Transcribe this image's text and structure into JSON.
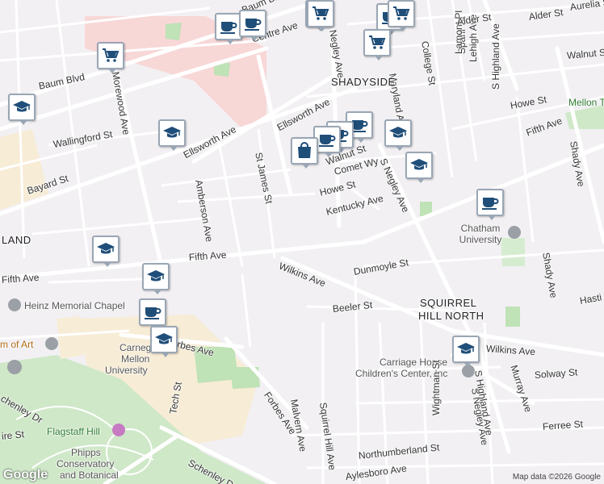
{
  "map": {
    "attribution": "Map data ©2026 Google",
    "logo_text": "Google",
    "colors": {
      "marker_icon": "#1f4e79",
      "marker_border": "#9aa6b4",
      "park": "#cfe8c8",
      "campus": "#f4cccc"
    },
    "labels": {
      "baum_blvd_1": "Baum Blvd",
      "baum_blvd_2": "Baum Blvd",
      "centre_ave": "Centre Ave",
      "s_negley_ave_1": "S Negley Ave",
      "s_negley_ave_2": "S Negley Ave",
      "negley_ave": "Negley Ave",
      "maryland_ave": "Maryland Ave",
      "college_st": "College St",
      "spahr_st": "Spahr St",
      "lamont_pl": "Lamont Pl",
      "lehigh_ave": "Lehigh Ave",
      "s_highland_ave": "S Highland Ave",
      "alder_st_1": "Alder St",
      "alder_st_2": "Alder St",
      "aurelia_st": "Aurelia St",
      "walnut_st_1": "Walnut St",
      "walnut_st_2": "Walnut St",
      "shadyside": "SHADYSIDE",
      "howe_st_1": "Howe St",
      "howe_st_2": "Howe St",
      "fifth_ave_1": "Fifth Ave",
      "fifth_ave_2": "Fifth Ave",
      "fifth_ave_3": "Fifth Ave",
      "shady_ave_1": "Shady Ave",
      "shady_ave_2": "Shady Ave",
      "mellon_tennis": "Mellon Tennis",
      "morewood_ave": "Morewood Ave",
      "wallingford_st": "Wallingford St",
      "ellsworth_ave_1": "Ellsworth Ave",
      "ellsworth_ave_2": "Ellsworth Ave",
      "st_james_st": "St James St",
      "amberson_ave": "Amberson Ave",
      "bayard_st": "Bayard St",
      "comet_wy": "Comet Wy",
      "kentucky_ave": "Kentucky Ave",
      "chatham_university": "Chatham University",
      "wilkins_ave_1": "Wilkins Ave",
      "wilkins_ave_2": "Wilkins Ave",
      "dunmoyle_st": "Dunmoyle St",
      "squirrel_hill_north_1": "SQUIRREL",
      "squirrel_hill_north_2": "HILL NORTH",
      "beeler_st": "Beeler St",
      "heinz_chapel": "Heinz Memorial Chapel",
      "museum_art": "m of Art",
      "land": "LAND",
      "carnegie_mellon_1": "Carnegie",
      "carnegie_mellon_2": "Mellon",
      "carnegie_mellon_3": "University",
      "forbes_ave_1": "Forbes Ave",
      "forbes_ave_2": "Forbes Ave",
      "carriage_house_1": "Carriage House",
      "carriage_house_2": "Children's Center, Inc",
      "solway_st": "Solway St",
      "murray_ave": "Murray Ave",
      "wightman_st": "Wightman St",
      "malvern_ave": "Malvern Ave",
      "squirrel_hill_ave": "Squirrel Hill Ave",
      "schenley_dr_1": "chenley Dr",
      "schenley_dr_2": "Schenley Dr",
      "tech_st": "Tech St",
      "flagstaff_hill": "Flagstaff Hill",
      "phipps_1": "Phipps",
      "phipps_2": "Conservatory",
      "phipps_3": "and Botanical",
      "ferree_st": "Ferree St",
      "northumberland_st": "Northumberland St",
      "aylesboro_ave": "Aylesboro Ave",
      "frew_st": "ire St",
      "hastings": "Hasti",
      "s_highland_south": "S Highland Ave",
      "s_negley_south": "S Negley Ave"
    },
    "markers": [
      {
        "type": "shopping-cart",
        "label": "Grocery"
      },
      {
        "type": "coffee-cup",
        "label": "Cafe"
      },
      {
        "type": "coffee-cup",
        "label": "Cafe"
      },
      {
        "type": "shopping-cart",
        "label": "Grocery"
      },
      {
        "type": "coffee-cup",
        "label": "Cafe"
      },
      {
        "type": "shopping-cart",
        "label": "Grocery"
      },
      {
        "type": "shopping-cart",
        "label": "Grocery"
      },
      {
        "type": "shopping-cart",
        "label": "Grocery"
      },
      {
        "type": "graduation-cap",
        "label": "School"
      },
      {
        "type": "graduation-cap",
        "label": "School"
      },
      {
        "type": "coffee-cup",
        "label": "Cafe"
      },
      {
        "type": "coffee-cup",
        "label": "Cafe"
      },
      {
        "type": "coffee-cup",
        "label": "Cafe"
      },
      {
        "type": "shopping-bag",
        "label": "Store"
      },
      {
        "type": "graduation-cap",
        "label": "School"
      },
      {
        "type": "graduation-cap",
        "label": "School"
      },
      {
        "type": "coffee-cup",
        "label": "Cafe"
      },
      {
        "type": "graduation-cap",
        "label": "School"
      },
      {
        "type": "graduation-cap",
        "label": "School"
      },
      {
        "type": "coffee-cup",
        "label": "Cafe"
      },
      {
        "type": "graduation-cap",
        "label": "School"
      },
      {
        "type": "graduation-cap",
        "label": "School"
      }
    ]
  }
}
